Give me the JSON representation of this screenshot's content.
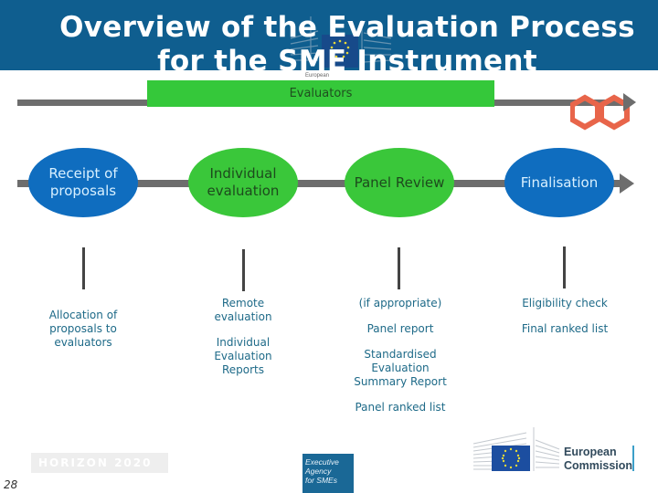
{
  "header": {
    "title_line1": "Overview of the Evaluation Process",
    "title_line2": "for the SME Instrument",
    "watermark_caption": "European"
  },
  "evaluators_bar": {
    "label": "Evaluators",
    "icon": "hexagon-pair-icon"
  },
  "stages": [
    {
      "label_line1": "Receipt of",
      "label_line2": "proposals",
      "color": "#0f6dbf",
      "details": [
        "Allocation of proposals to evaluators"
      ]
    },
    {
      "label_line1": "Individual",
      "label_line2": "evaluation",
      "color": "#3ac73a",
      "details": [
        "Remote evaluation",
        "Individual Evaluation Reports"
      ]
    },
    {
      "label_line1": "Panel Review",
      "label_line2": "",
      "color": "#3ac73a",
      "details": [
        "(if appropriate)",
        "Panel report",
        "Standardised Evaluation Summary Report",
        "Panel ranked list"
      ]
    },
    {
      "label_line1": "Finalisation",
      "label_line2": "",
      "color": "#0f6dbf",
      "details": [
        "Eligibility check",
        "Final ranked list"
      ]
    }
  ],
  "footer": {
    "programme_label": "HORIZON 2020",
    "page_number": "28",
    "agency_logo": [
      "Executive",
      "Agency",
      "for SMEs"
    ],
    "commission_logo": [
      "European",
      "Commission"
    ]
  },
  "colors": {
    "header_blue": "#0f5e8f",
    "green": "#35c83a",
    "blue": "#0f6dbf",
    "line_gray": "#6d6d6d",
    "detail_text": "#1e6a88",
    "hex_orange": "#e8654a"
  }
}
